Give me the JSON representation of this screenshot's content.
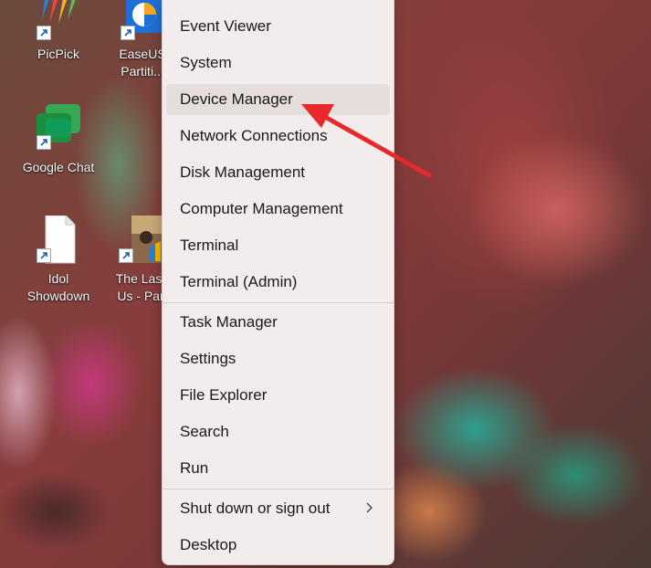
{
  "desktop": {
    "icons": [
      {
        "label": "PicPick",
        "label2": ""
      },
      {
        "label": "EaseUS",
        "label2": "Partiti..."
      },
      {
        "label": "Google Chat",
        "label2": ""
      },
      {
        "label": "Idol",
        "label2": "Showdown"
      },
      {
        "label": "The Last",
        "label2": "Us - Par"
      }
    ]
  },
  "menu": {
    "items": [
      {
        "label": "Event Viewer"
      },
      {
        "label": "System"
      },
      {
        "label": "Device Manager"
      },
      {
        "label": "Network Connections"
      },
      {
        "label": "Disk Management"
      },
      {
        "label": "Computer Management"
      },
      {
        "label": "Terminal"
      },
      {
        "label": "Terminal (Admin)"
      },
      {
        "label": "Task Manager"
      },
      {
        "label": "Settings"
      },
      {
        "label": "File Explorer"
      },
      {
        "label": "Search"
      },
      {
        "label": "Run"
      },
      {
        "label": "Shut down or sign out"
      },
      {
        "label": "Desktop"
      }
    ],
    "highlighted": "Device Manager"
  },
  "colors": {
    "annotation_arrow": "#e8292b",
    "menu_bg": "#f3ecec",
    "hover_bg": "#e6dddd"
  }
}
